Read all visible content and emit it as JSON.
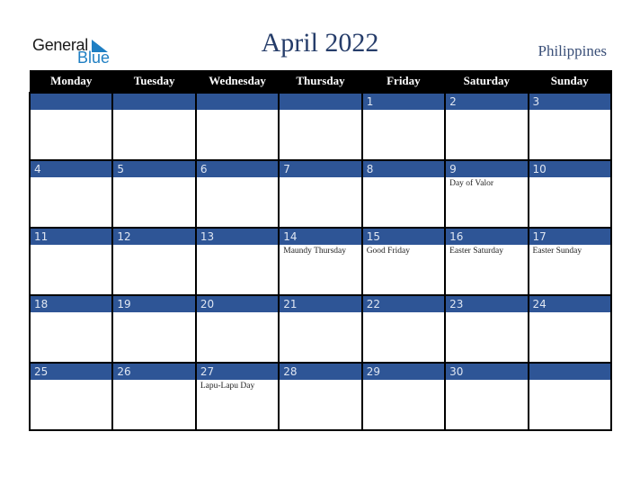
{
  "logo": {
    "line1": "General",
    "line2": "Blue"
  },
  "title": "April 2022",
  "country": "Philippines",
  "colors": {
    "band": "#2e5596",
    "header": "#000000",
    "title": "#263d6a",
    "logo_blue": "#1f7fc3"
  },
  "weekdays": [
    "Monday",
    "Tuesday",
    "Wednesday",
    "Thursday",
    "Friday",
    "Saturday",
    "Sunday"
  ],
  "weeks": [
    [
      {
        "day": "",
        "holiday": ""
      },
      {
        "day": "",
        "holiday": ""
      },
      {
        "day": "",
        "holiday": ""
      },
      {
        "day": "",
        "holiday": ""
      },
      {
        "day": "1",
        "holiday": ""
      },
      {
        "day": "2",
        "holiday": ""
      },
      {
        "day": "3",
        "holiday": ""
      }
    ],
    [
      {
        "day": "4",
        "holiday": ""
      },
      {
        "day": "5",
        "holiday": ""
      },
      {
        "day": "6",
        "holiday": ""
      },
      {
        "day": "7",
        "holiday": ""
      },
      {
        "day": "8",
        "holiday": ""
      },
      {
        "day": "9",
        "holiday": "Day of Valor"
      },
      {
        "day": "10",
        "holiday": ""
      }
    ],
    [
      {
        "day": "11",
        "holiday": ""
      },
      {
        "day": "12",
        "holiday": ""
      },
      {
        "day": "13",
        "holiday": ""
      },
      {
        "day": "14",
        "holiday": "Maundy Thursday"
      },
      {
        "day": "15",
        "holiday": "Good Friday"
      },
      {
        "day": "16",
        "holiday": "Easter Saturday"
      },
      {
        "day": "17",
        "holiday": "Easter Sunday"
      }
    ],
    [
      {
        "day": "18",
        "holiday": ""
      },
      {
        "day": "19",
        "holiday": ""
      },
      {
        "day": "20",
        "holiday": ""
      },
      {
        "day": "21",
        "holiday": ""
      },
      {
        "day": "22",
        "holiday": ""
      },
      {
        "day": "23",
        "holiday": ""
      },
      {
        "day": "24",
        "holiday": ""
      }
    ],
    [
      {
        "day": "25",
        "holiday": ""
      },
      {
        "day": "26",
        "holiday": ""
      },
      {
        "day": "27",
        "holiday": "Lapu-Lapu Day"
      },
      {
        "day": "28",
        "holiday": ""
      },
      {
        "day": "29",
        "holiday": ""
      },
      {
        "day": "30",
        "holiday": ""
      },
      {
        "day": "",
        "holiday": ""
      }
    ]
  ]
}
